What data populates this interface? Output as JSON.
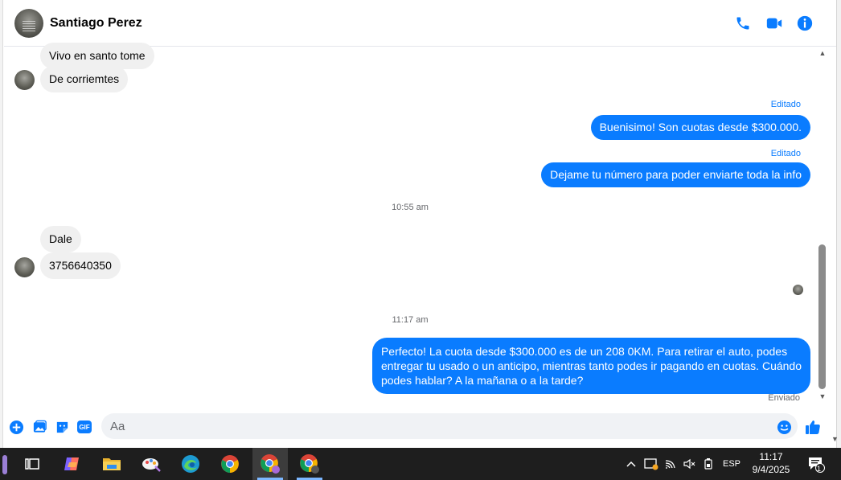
{
  "header": {
    "contact_name": "Santiago Perez",
    "icons": [
      "phone-icon",
      "video-camera-icon",
      "info-icon"
    ],
    "accent_color": "#0a7cff"
  },
  "messages": {
    "in_1": "Vivo en santo tome",
    "in_2": "De corriemtes",
    "edited_label": "Editado",
    "out_1": "Buenisimo!  Son cuotas desde $300.000.",
    "out_2": "Dejame tu número para poder enviarte toda la info",
    "time_1": "10:55 am",
    "in_3": "Dale",
    "in_4": "3756640350",
    "time_2": "11:17 am",
    "out_3_line1": "Perfecto! La cuota desde $300.000 es de un 208 0KM. Para retirar el auto, podes",
    "out_3_line2": "entregar tu usado o un anticipo, mientras tanto podes ir pagando en cuotas. Cuándo",
    "out_3_line3": "podes hablar? A la mañana o a la tarde?",
    "status": "Enviado"
  },
  "composer": {
    "placeholder": "Aa",
    "gif_label": "GIF",
    "icons": [
      "plus-icon",
      "photo-icon",
      "sticker-icon",
      "gif-icon",
      "emoji-icon",
      "thumbs-up-icon"
    ]
  },
  "taskbar": {
    "apps": [
      "task-view-icon",
      "copilot-icon",
      "file-explorer-icon",
      "paint-icon",
      "edge-icon",
      "chrome-icon",
      "chrome-profile-icon",
      "chrome-profile-2-icon"
    ],
    "language": "ESP",
    "time": "11:17",
    "date": "9/4/2025",
    "notification_count": "1"
  }
}
